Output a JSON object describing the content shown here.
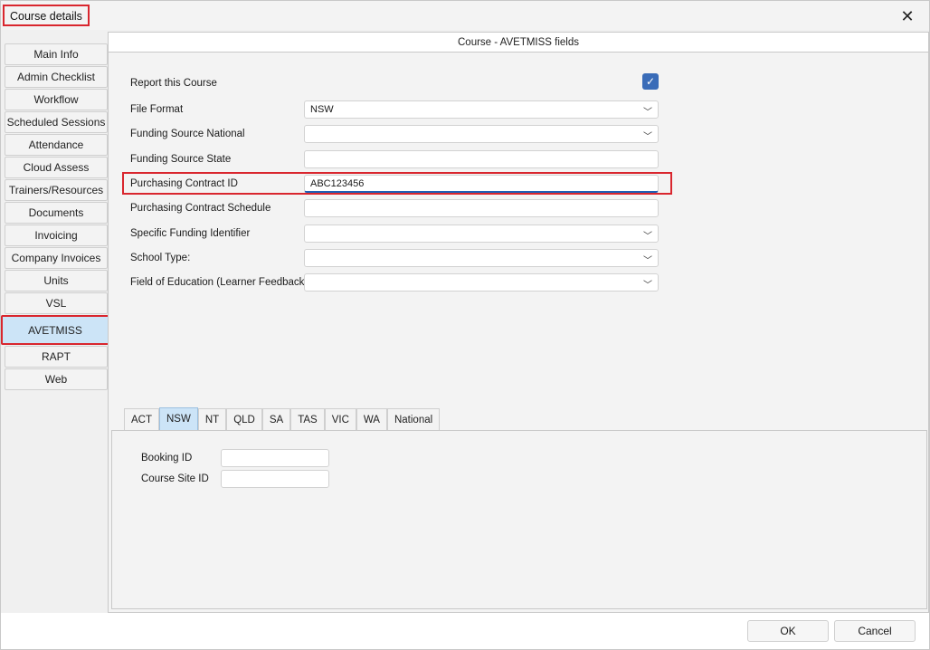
{
  "window": {
    "title": "Course details"
  },
  "sidebar": {
    "items": [
      {
        "label": "Main Info"
      },
      {
        "label": "Admin Checklist"
      },
      {
        "label": "Workflow"
      },
      {
        "label": "Scheduled Sessions"
      },
      {
        "label": "Attendance"
      },
      {
        "label": "Cloud Assess"
      },
      {
        "label": "Trainers/Resources"
      },
      {
        "label": "Documents"
      },
      {
        "label": "Invoicing"
      },
      {
        "label": "Company Invoices"
      },
      {
        "label": "Units"
      },
      {
        "label": "VSL"
      },
      {
        "label": "AVETMISS"
      },
      {
        "label": "RAPT"
      },
      {
        "label": "Web"
      }
    ],
    "active": "AVETMISS"
  },
  "main": {
    "header": "Course - AVETMISS fields",
    "report_label": "Report this Course",
    "report_checked": true,
    "fields": {
      "file_format": {
        "label": "File Format",
        "value": "NSW"
      },
      "funding_national": {
        "label": "Funding Source National",
        "value": ""
      },
      "funding_state": {
        "label": "Funding Source State",
        "value": ""
      },
      "purchasing_contract_id": {
        "label": "Purchasing Contract ID",
        "value": "ABC123456"
      },
      "purchasing_contract_schedule": {
        "label": "Purchasing Contract Schedule",
        "value": ""
      },
      "specific_funding": {
        "label": "Specific Funding Identifier",
        "value": ""
      },
      "school_type": {
        "label": "School Type:",
        "value": ""
      },
      "field_of_education": {
        "label": "Field of Education (Learner Feedback)",
        "value": ""
      }
    }
  },
  "state_tabs": {
    "items": [
      "ACT",
      "NSW",
      "NT",
      "QLD",
      "SA",
      "TAS",
      "VIC",
      "WA",
      "National"
    ],
    "active": "NSW"
  },
  "nsw_panel": {
    "booking_id_label": "Booking ID",
    "booking_id_value": "",
    "course_site_id_label": "Course Site ID",
    "course_site_id_value": ""
  },
  "buttons": {
    "ok": "OK",
    "cancel": "Cancel"
  }
}
